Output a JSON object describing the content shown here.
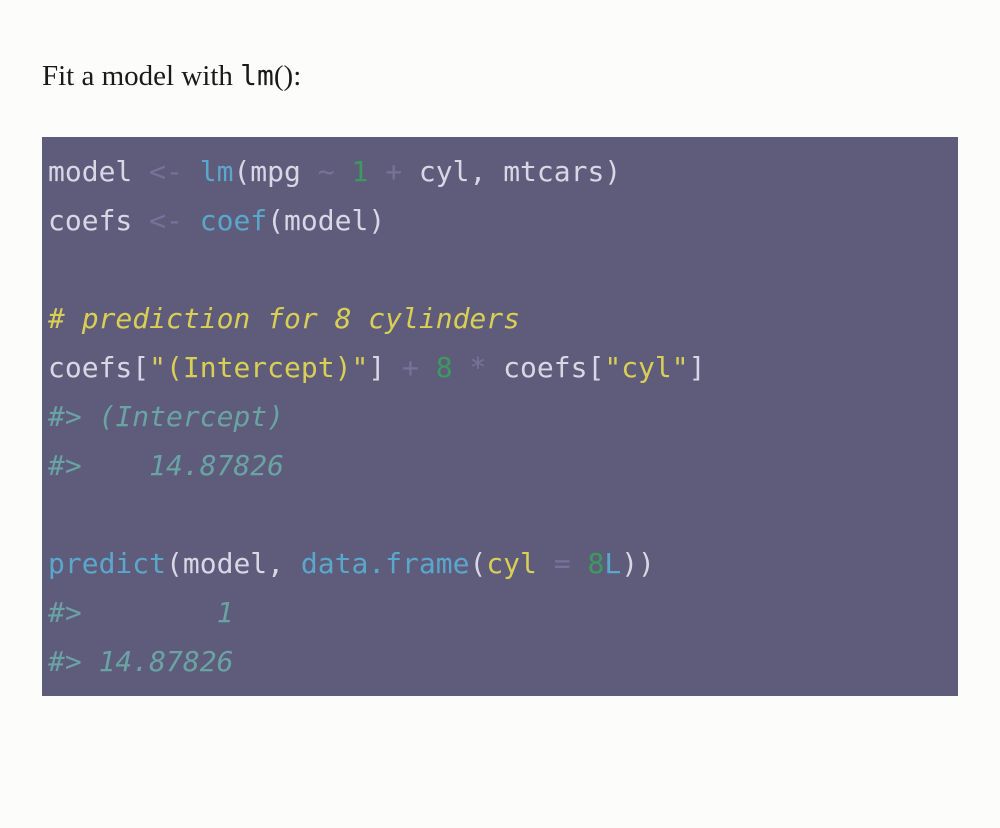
{
  "intro": {
    "prefix": "Fit a model with ",
    "fn": "lm",
    "suffix": "():"
  },
  "code": {
    "l1": {
      "a": "model ",
      "op1": "<-",
      "b": " ",
      "fn": "lm",
      "c": "(mpg ",
      "tilde": "~",
      "d": " ",
      "num": "1",
      "e": " ",
      "plus": "+",
      "f": " cyl, mtcars)"
    },
    "l2": {
      "a": "coefs ",
      "op1": "<-",
      "b": " ",
      "fn": "coef",
      "c": "(model)"
    },
    "l3": {
      "blank": " "
    },
    "l4": {
      "comment": "# prediction for 8 cylinders"
    },
    "l5": {
      "a": "coefs[",
      "s1": "\"(Intercept)\"",
      "b": "] ",
      "plus": "+",
      "c": " ",
      "num": "8",
      "d": " ",
      "star": "*",
      "e": " coefs[",
      "s2": "\"cyl\"",
      "f": "]"
    },
    "l6": {
      "out": "#> (Intercept) "
    },
    "l7": {
      "out": "#>    14.87826 "
    },
    "l8": {
      "blank": " "
    },
    "l9": {
      "fn1": "predict",
      "a": "(model, ",
      "fn2": "data.frame",
      "b": "(",
      "arg": "cyl",
      "c": " ",
      "eq": "=",
      "d": " ",
      "num": "8",
      "L": "L",
      "e": "))"
    },
    "l10": {
      "out": "#>        1 "
    },
    "l11": {
      "out": "#> 14.87826"
    }
  }
}
